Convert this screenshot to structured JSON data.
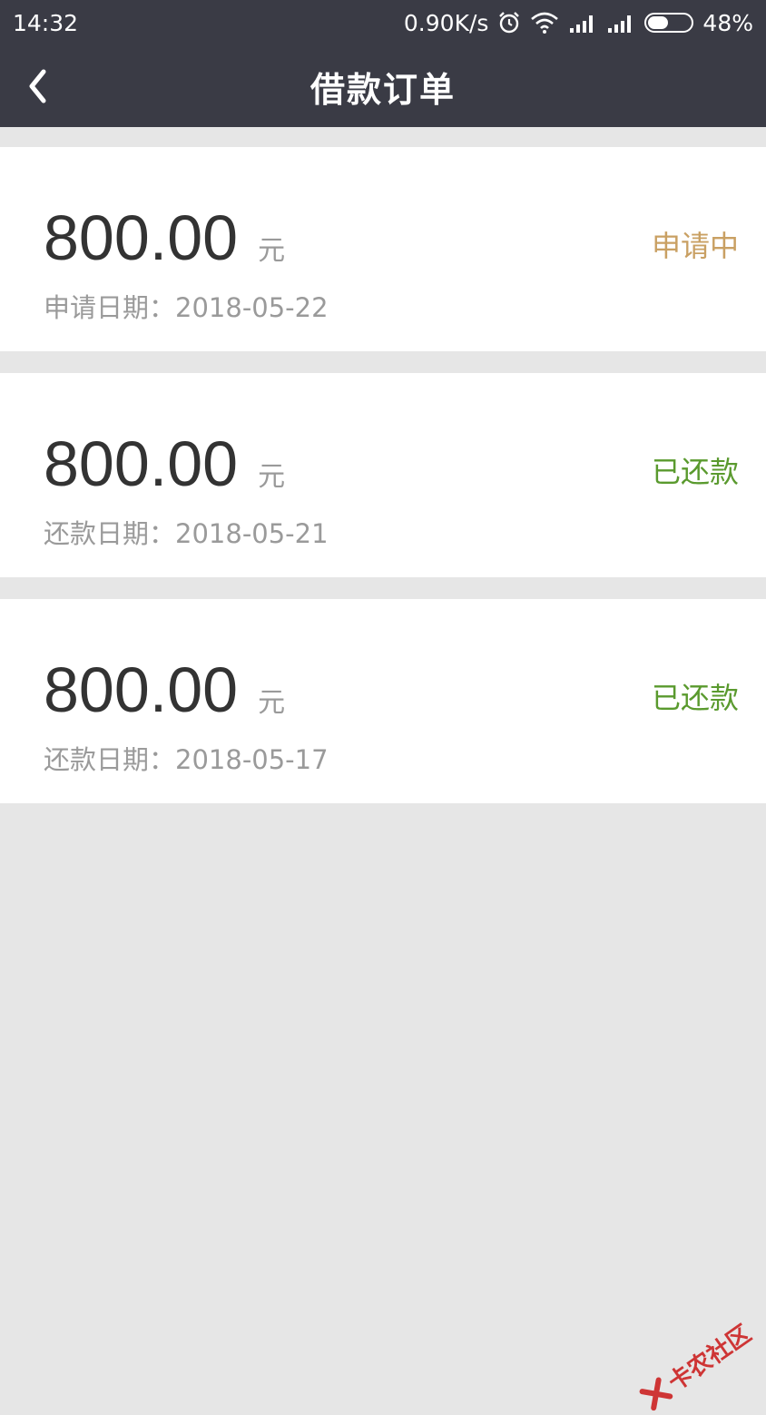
{
  "status_bar": {
    "time": "14:32",
    "net_speed": "0.90K/s",
    "battery_text": "48%",
    "battery_level": 0.48
  },
  "nav": {
    "title": "借款订单"
  },
  "orders": [
    {
      "amount": "800.00",
      "unit": "元",
      "date_label": "申请日期：",
      "date": "2018-05-22",
      "status": "申请中",
      "status_color": "#c9a063"
    },
    {
      "amount": "800.00",
      "unit": "元",
      "date_label": "还款日期：",
      "date": "2018-05-21",
      "status": "已还款",
      "status_color": "#5a9a2e"
    },
    {
      "amount": "800.00",
      "unit": "元",
      "date_label": "还款日期：",
      "date": "2018-05-17",
      "status": "已还款",
      "status_color": "#5a9a2e"
    }
  ],
  "watermark": {
    "text": "卡农社区"
  },
  "colors": {
    "header_bg": "#3a3b45",
    "page_bg": "#e6e6e6",
    "card_bg": "#ffffff"
  }
}
